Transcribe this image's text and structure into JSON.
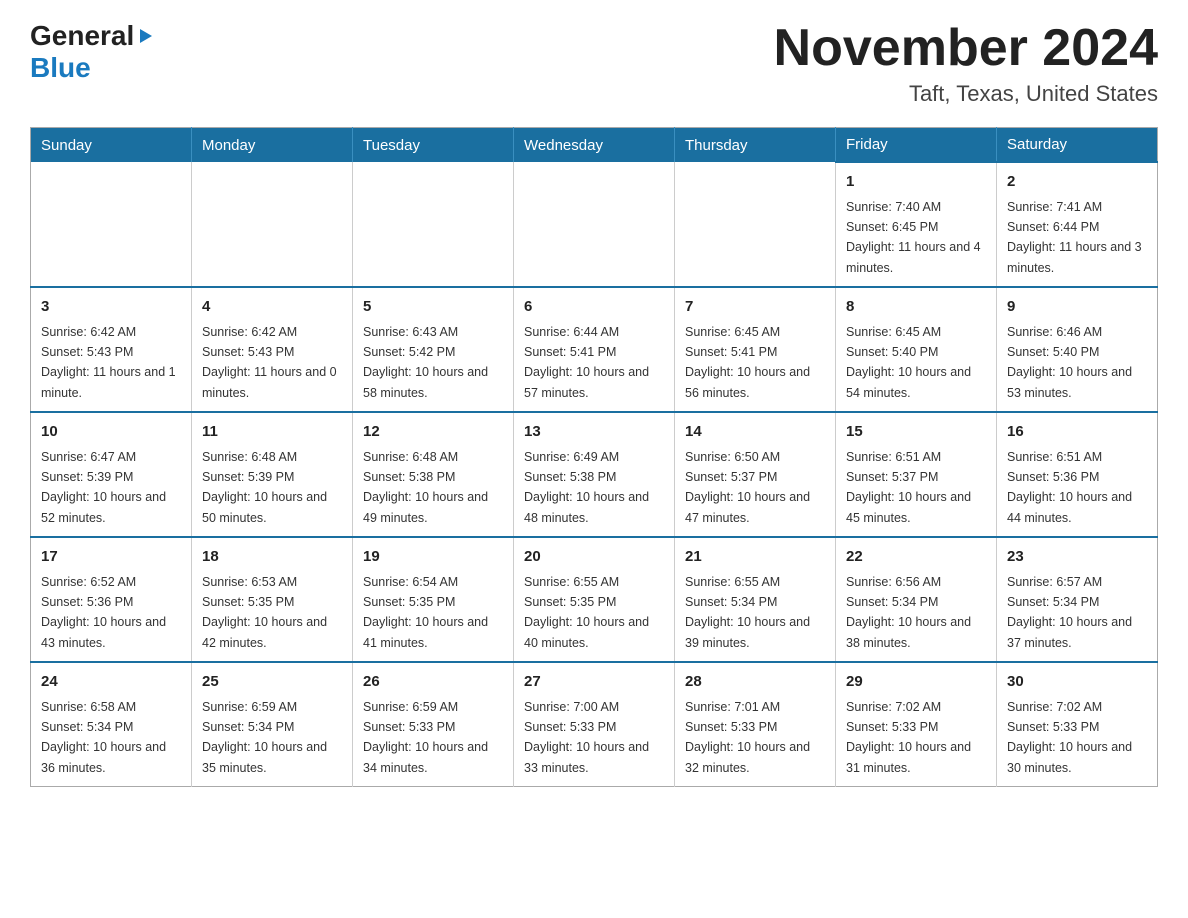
{
  "header": {
    "logo": {
      "general": "General",
      "blue": "Blue"
    },
    "month": "November 2024",
    "location": "Taft, Texas, United States"
  },
  "calendar": {
    "days_of_week": [
      "Sunday",
      "Monday",
      "Tuesday",
      "Wednesday",
      "Thursday",
      "Friday",
      "Saturday"
    ],
    "weeks": [
      [
        {
          "day": "",
          "info": ""
        },
        {
          "day": "",
          "info": ""
        },
        {
          "day": "",
          "info": ""
        },
        {
          "day": "",
          "info": ""
        },
        {
          "day": "",
          "info": ""
        },
        {
          "day": "1",
          "info": "Sunrise: 7:40 AM\nSunset: 6:45 PM\nDaylight: 11 hours and 4 minutes."
        },
        {
          "day": "2",
          "info": "Sunrise: 7:41 AM\nSunset: 6:44 PM\nDaylight: 11 hours and 3 minutes."
        }
      ],
      [
        {
          "day": "3",
          "info": "Sunrise: 6:42 AM\nSunset: 5:43 PM\nDaylight: 11 hours and 1 minute."
        },
        {
          "day": "4",
          "info": "Sunrise: 6:42 AM\nSunset: 5:43 PM\nDaylight: 11 hours and 0 minutes."
        },
        {
          "day": "5",
          "info": "Sunrise: 6:43 AM\nSunset: 5:42 PM\nDaylight: 10 hours and 58 minutes."
        },
        {
          "day": "6",
          "info": "Sunrise: 6:44 AM\nSunset: 5:41 PM\nDaylight: 10 hours and 57 minutes."
        },
        {
          "day": "7",
          "info": "Sunrise: 6:45 AM\nSunset: 5:41 PM\nDaylight: 10 hours and 56 minutes."
        },
        {
          "day": "8",
          "info": "Sunrise: 6:45 AM\nSunset: 5:40 PM\nDaylight: 10 hours and 54 minutes."
        },
        {
          "day": "9",
          "info": "Sunrise: 6:46 AM\nSunset: 5:40 PM\nDaylight: 10 hours and 53 minutes."
        }
      ],
      [
        {
          "day": "10",
          "info": "Sunrise: 6:47 AM\nSunset: 5:39 PM\nDaylight: 10 hours and 52 minutes."
        },
        {
          "day": "11",
          "info": "Sunrise: 6:48 AM\nSunset: 5:39 PM\nDaylight: 10 hours and 50 minutes."
        },
        {
          "day": "12",
          "info": "Sunrise: 6:48 AM\nSunset: 5:38 PM\nDaylight: 10 hours and 49 minutes."
        },
        {
          "day": "13",
          "info": "Sunrise: 6:49 AM\nSunset: 5:38 PM\nDaylight: 10 hours and 48 minutes."
        },
        {
          "day": "14",
          "info": "Sunrise: 6:50 AM\nSunset: 5:37 PM\nDaylight: 10 hours and 47 minutes."
        },
        {
          "day": "15",
          "info": "Sunrise: 6:51 AM\nSunset: 5:37 PM\nDaylight: 10 hours and 45 minutes."
        },
        {
          "day": "16",
          "info": "Sunrise: 6:51 AM\nSunset: 5:36 PM\nDaylight: 10 hours and 44 minutes."
        }
      ],
      [
        {
          "day": "17",
          "info": "Sunrise: 6:52 AM\nSunset: 5:36 PM\nDaylight: 10 hours and 43 minutes."
        },
        {
          "day": "18",
          "info": "Sunrise: 6:53 AM\nSunset: 5:35 PM\nDaylight: 10 hours and 42 minutes."
        },
        {
          "day": "19",
          "info": "Sunrise: 6:54 AM\nSunset: 5:35 PM\nDaylight: 10 hours and 41 minutes."
        },
        {
          "day": "20",
          "info": "Sunrise: 6:55 AM\nSunset: 5:35 PM\nDaylight: 10 hours and 40 minutes."
        },
        {
          "day": "21",
          "info": "Sunrise: 6:55 AM\nSunset: 5:34 PM\nDaylight: 10 hours and 39 minutes."
        },
        {
          "day": "22",
          "info": "Sunrise: 6:56 AM\nSunset: 5:34 PM\nDaylight: 10 hours and 38 minutes."
        },
        {
          "day": "23",
          "info": "Sunrise: 6:57 AM\nSunset: 5:34 PM\nDaylight: 10 hours and 37 minutes."
        }
      ],
      [
        {
          "day": "24",
          "info": "Sunrise: 6:58 AM\nSunset: 5:34 PM\nDaylight: 10 hours and 36 minutes."
        },
        {
          "day": "25",
          "info": "Sunrise: 6:59 AM\nSunset: 5:34 PM\nDaylight: 10 hours and 35 minutes."
        },
        {
          "day": "26",
          "info": "Sunrise: 6:59 AM\nSunset: 5:33 PM\nDaylight: 10 hours and 34 minutes."
        },
        {
          "day": "27",
          "info": "Sunrise: 7:00 AM\nSunset: 5:33 PM\nDaylight: 10 hours and 33 minutes."
        },
        {
          "day": "28",
          "info": "Sunrise: 7:01 AM\nSunset: 5:33 PM\nDaylight: 10 hours and 32 minutes."
        },
        {
          "day": "29",
          "info": "Sunrise: 7:02 AM\nSunset: 5:33 PM\nDaylight: 10 hours and 31 minutes."
        },
        {
          "day": "30",
          "info": "Sunrise: 7:02 AM\nSunset: 5:33 PM\nDaylight: 10 hours and 30 minutes."
        }
      ]
    ]
  }
}
